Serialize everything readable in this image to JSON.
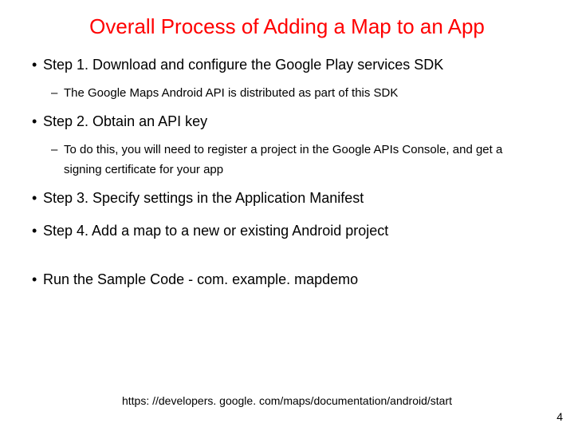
{
  "title": "Overall Process of Adding a Map to an App",
  "bullets": {
    "step1": "Step 1. Download and configure the Google Play services SDK",
    "step1_sub": "The Google Maps Android API is distributed as part of this SDK",
    "step2": "Step 2. Obtain an API key",
    "step2_sub": "To do this, you will need to register a project in the Google APIs Console, and get a signing certificate for your app",
    "step3": "Step 3. Specify settings in the Application Manifest",
    "step4": "Step 4. Add a map to a new or existing Android project",
    "run": "Run the Sample Code - com. example. mapdemo"
  },
  "footer_link": "https: //developers. google. com/maps/documentation/android/start",
  "page_number": "4"
}
